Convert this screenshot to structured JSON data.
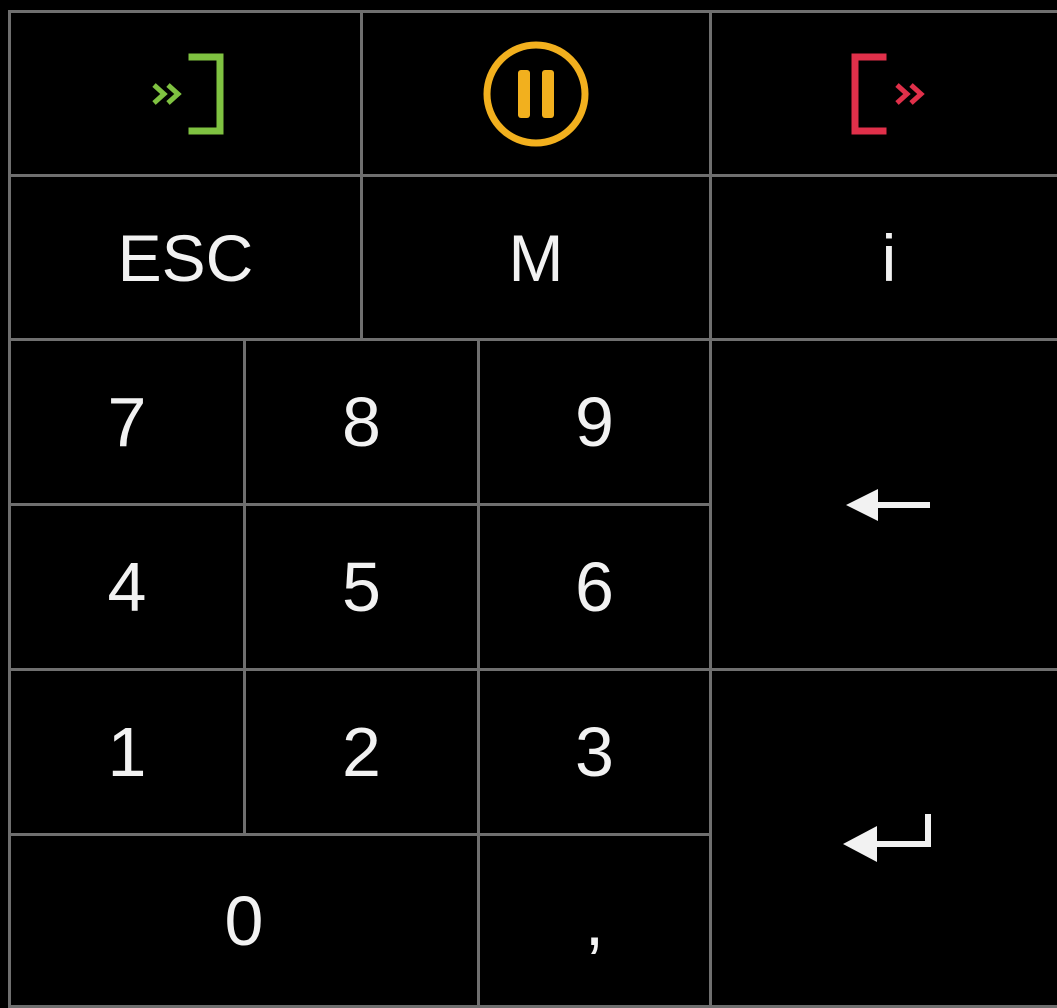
{
  "keypad": {
    "function_row": {
      "login_icon": "sign-in-icon",
      "pause_icon": "pause-circle-icon",
      "logout_icon": "sign-out-icon"
    },
    "command_row": {
      "esc": "ESC",
      "m": "M",
      "i": "i"
    },
    "digits": {
      "k7": "7",
      "k8": "8",
      "k9": "9",
      "k4": "4",
      "k5": "5",
      "k6": "6",
      "k1": "1",
      "k2": "2",
      "k3": "3",
      "k0": "0",
      "comma": ","
    },
    "backspace_icon": "backspace-arrow-icon",
    "enter_icon": "enter-return-icon"
  },
  "colors": {
    "background": "#000000",
    "border": "#6f6f6f",
    "text": "#f2f2f2",
    "login_green": "#7fc241",
    "pause_amber": "#f2b01e",
    "logout_red": "#e0304a"
  }
}
